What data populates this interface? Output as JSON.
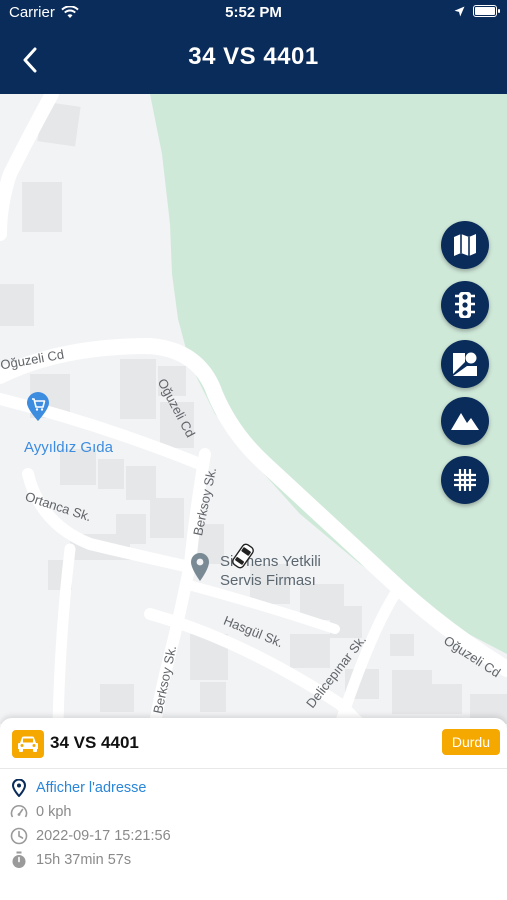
{
  "status_bar": {
    "carrier": "Carrier",
    "time": "5:52 PM"
  },
  "header": {
    "title": "34 VS 4401"
  },
  "map": {
    "streets": {
      "oguzeli_cd_1": "Oğuzeli Cd",
      "oguzeli_cd_2": "Oğuzeli Cd",
      "oguzeli_cd_3": "Oğuzeli Cd",
      "berksoy_sk_1": "Berksoy Sk.",
      "berksoy_sk_2": "Berksoy Sk.",
      "ortanca_sk": "Ortanca Sk.",
      "hasgul_sk": "Hasgül Sk.",
      "delicepinar_sk": "Delicepınar Sk."
    },
    "pois": {
      "grocery": "Ayyıldız Gıda",
      "service_line1": "Siemens Yetkili",
      "service_line2": "Servis Firması"
    }
  },
  "map_controls": [
    "map-type-icon",
    "traffic-icon",
    "places-icon",
    "terrain-icon",
    "grid-icon"
  ],
  "panel": {
    "plate": "34 VS 4401",
    "status": "Durdu",
    "address_link": "Afficher l'adresse",
    "speed": "0 kph",
    "datetime": "2022-09-17 15:21:56",
    "duration": "15h 37min 57s"
  },
  "colors": {
    "header": "#0a2c5a",
    "accent": "#f4a800",
    "link": "#2a86d8",
    "park": "#cfe9d9"
  }
}
